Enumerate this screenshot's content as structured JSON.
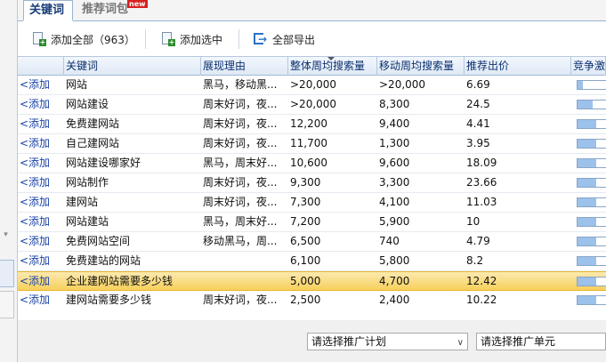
{
  "tabs": [
    {
      "label": "关键词",
      "active": true
    },
    {
      "label": "推荐词包",
      "active": false
    }
  ],
  "new_badge": "new",
  "toolbar": {
    "add_all": "添加全部（963）",
    "add_selected": "添加选中",
    "export_all": "全部导出"
  },
  "columns": [
    "",
    "关键词",
    "展现理由",
    "整体周均搜索量",
    "移动周均搜索量",
    "推荐出价",
    "竞争激烈程度"
  ],
  "add_label": "<添加",
  "rows": [
    {
      "keyword": "网站",
      "reason": "黑马，移动黑...",
      "total": ">20,000",
      "mobile": ">20,000",
      "bid": "6.69",
      "competition": 0.15
    },
    {
      "keyword": "网站建设",
      "reason": "周末好词，夜...",
      "total": ">20,000",
      "mobile": "8,300",
      "bid": "24.5",
      "competition": 0.45
    },
    {
      "keyword": "免费建网站",
      "reason": "周末好词，夜...",
      "total": "12,200",
      "mobile": "9,400",
      "bid": "4.41",
      "competition": 0.55
    },
    {
      "keyword": "自己建网站",
      "reason": "周末好词，夜...",
      "total": "11,700",
      "mobile": "1,300",
      "bid": "3.95",
      "competition": 0.55
    },
    {
      "keyword": "网站建设哪家好",
      "reason": "黑马，周末好...",
      "total": "10,600",
      "mobile": "9,600",
      "bid": "18.09",
      "competition": 0.55
    },
    {
      "keyword": "网站制作",
      "reason": "周末好词，夜...",
      "total": "9,300",
      "mobile": "3,300",
      "bid": "23.66",
      "competition": 0.55
    },
    {
      "keyword": "建网站",
      "reason": "周末好词，夜...",
      "total": "7,300",
      "mobile": "4,100",
      "bid": "11.03",
      "competition": 0.55
    },
    {
      "keyword": "网站建站",
      "reason": "黑马，周末好...",
      "total": "7,200",
      "mobile": "5,900",
      "bid": "10",
      "competition": 0.55
    },
    {
      "keyword": "免费网站空间",
      "reason": "移动黑马，周...",
      "total": "6,500",
      "mobile": "740",
      "bid": "4.79",
      "competition": 0.55
    },
    {
      "keyword": "免费建站的网站",
      "reason": "",
      "total": "6,100",
      "mobile": "5,800",
      "bid": "8.2",
      "competition": 0.55
    },
    {
      "keyword": "企业建网站需要多少钱",
      "reason": "",
      "total": "5,000",
      "mobile": "4,700",
      "bid": "12.42",
      "competition": 0.55,
      "selected": true
    },
    {
      "keyword": "建网站需要多少钱",
      "reason": "周末好词，夜...",
      "total": "2,500",
      "mobile": "2,400",
      "bid": "10.22",
      "competition": 0.55
    }
  ],
  "bottom": {
    "plan_select": "请选择推广计划",
    "unit_select": "请选择推广单元"
  }
}
